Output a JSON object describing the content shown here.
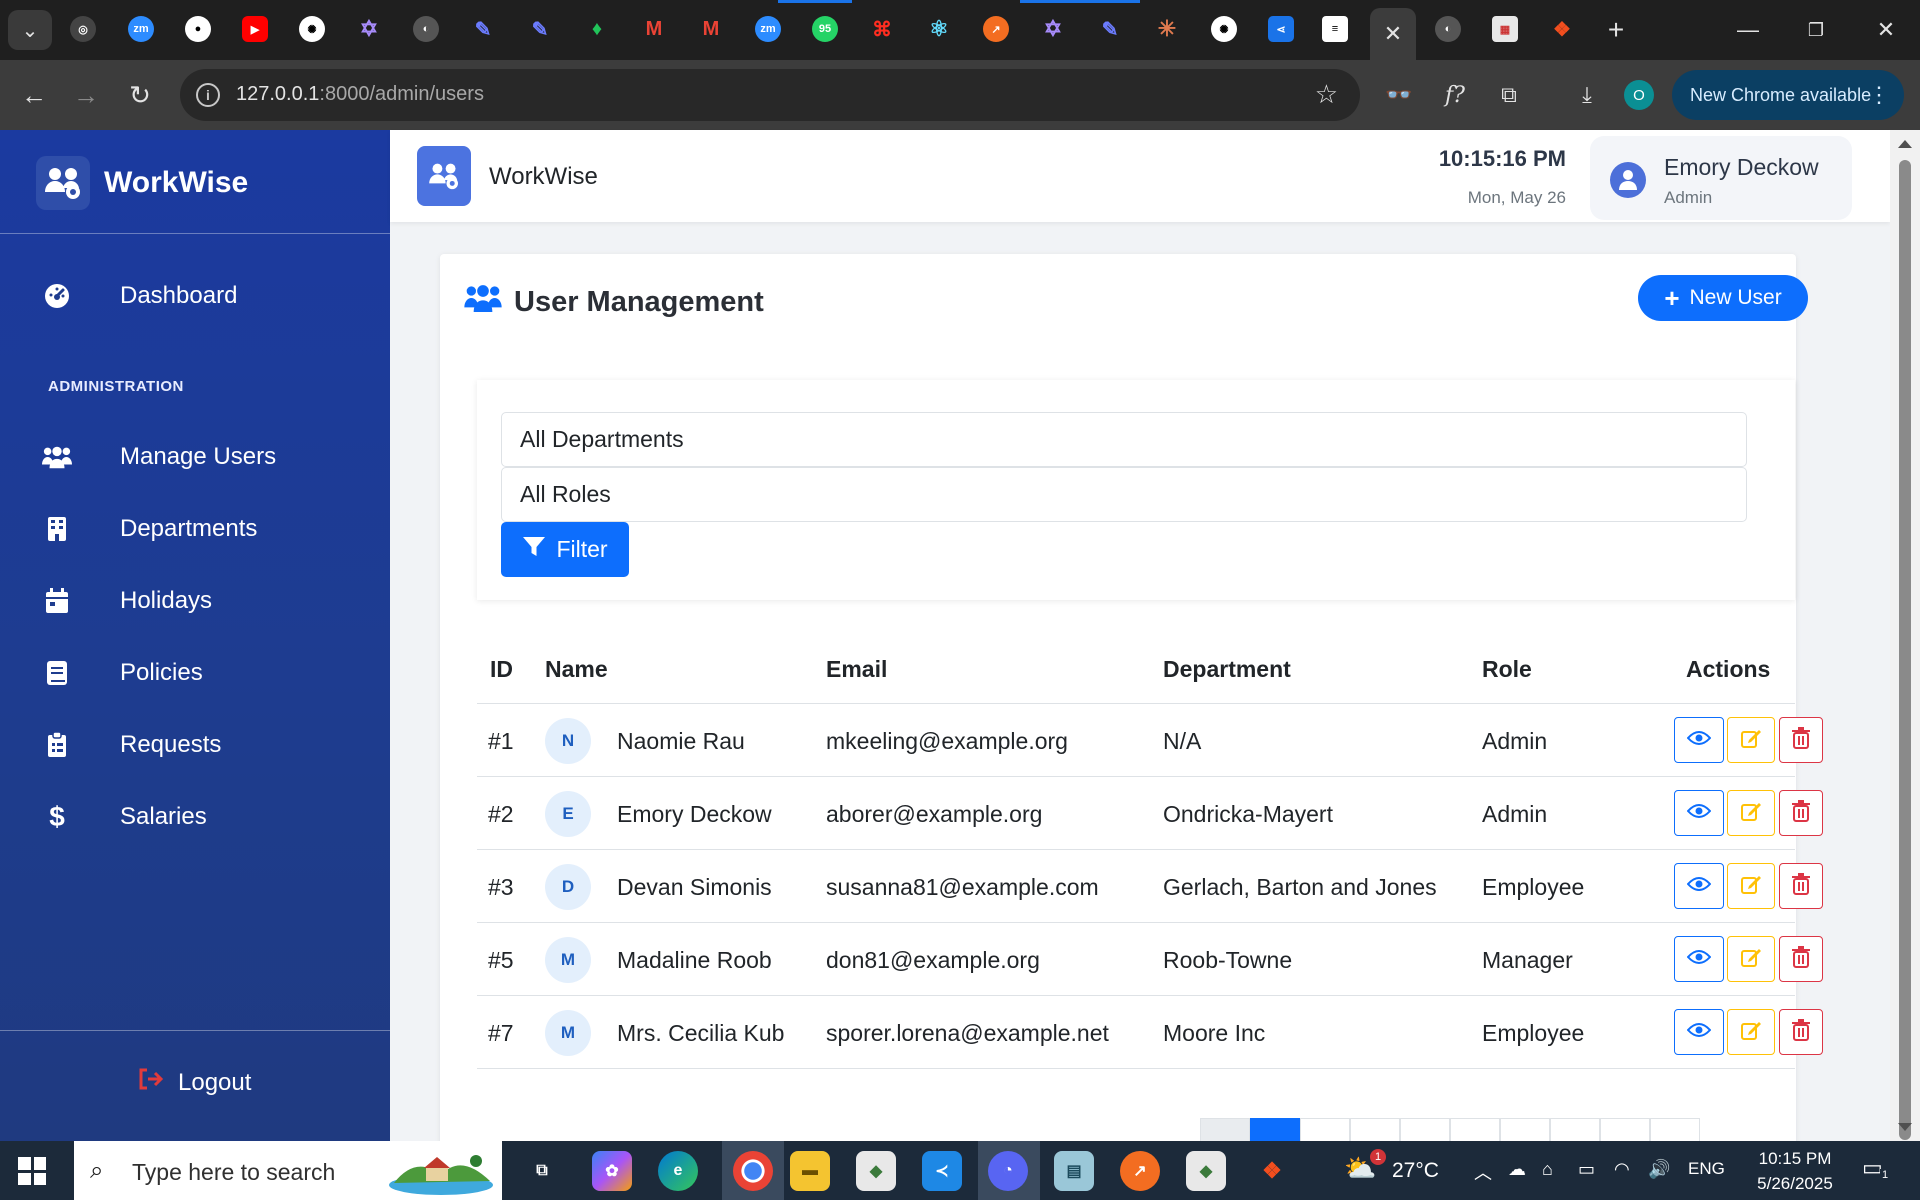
{
  "browser": {
    "url_host": "127.0.0.1",
    "url_path": ":8000/admin/users",
    "update_label": "New Chrome available",
    "profile_initial": "O"
  },
  "sidebar": {
    "brand": "WorkWise",
    "dashboard": "Dashboard",
    "section": "ADMINISTRATION",
    "items": [
      {
        "label": "Manage Users",
        "icon": "users-icon"
      },
      {
        "label": "Departments",
        "icon": "building-icon"
      },
      {
        "label": "Holidays",
        "icon": "calendar-icon"
      },
      {
        "label": "Policies",
        "icon": "book-icon"
      },
      {
        "label": "Requests",
        "icon": "clipboard-icon"
      },
      {
        "label": "Salaries",
        "icon": "dollar-icon"
      }
    ],
    "logout": "Logout"
  },
  "topbar": {
    "title": "WorkWise",
    "time": "10:15:16 PM",
    "date": "Mon, May 26",
    "user_name": "Emory Deckow",
    "user_role": "Admin"
  },
  "page": {
    "title": "User Management",
    "new_user": "New User",
    "filters": {
      "department": "All Departments",
      "role": "All Roles",
      "button": "Filter"
    }
  },
  "table": {
    "headers": {
      "id": "ID",
      "name": "Name",
      "email": "Email",
      "department": "Department",
      "role": "Role",
      "actions": "Actions"
    },
    "rows": [
      {
        "id": "#1",
        "initial": "N",
        "name": "Naomie Rau",
        "email": "mkeeling@example.org",
        "department": "N/A",
        "role": "Admin"
      },
      {
        "id": "#2",
        "initial": "E",
        "name": "Emory Deckow",
        "email": "aborer@example.org",
        "department": "Ondricka-Mayert",
        "role": "Admin"
      },
      {
        "id": "#3",
        "initial": "D",
        "name": "Devan Simonis",
        "email": "susanna81@example.com",
        "department": "Gerlach, Barton and Jones",
        "role": "Employee"
      },
      {
        "id": "#5",
        "initial": "M",
        "name": "Madaline Roob",
        "email": "don81@example.org",
        "department": "Roob-Towne",
        "role": "Manager"
      },
      {
        "id": "#7",
        "initial": "M",
        "name": "Mrs. Cecilia Kub",
        "email": "sporer.lorena@example.net",
        "department": "Moore Inc",
        "role": "Employee"
      }
    ]
  },
  "taskbar": {
    "search_placeholder": "Type here to search",
    "weather": "27°C",
    "language": "ENG",
    "time": "10:15 PM",
    "date": "5/26/2025",
    "weather_badge": "1",
    "notif_count": "1"
  },
  "colors": {
    "primary": "#0d6efd",
    "sidebar": "#1e3c8e",
    "edit": "#ffc107",
    "delete": "#dc3545"
  }
}
